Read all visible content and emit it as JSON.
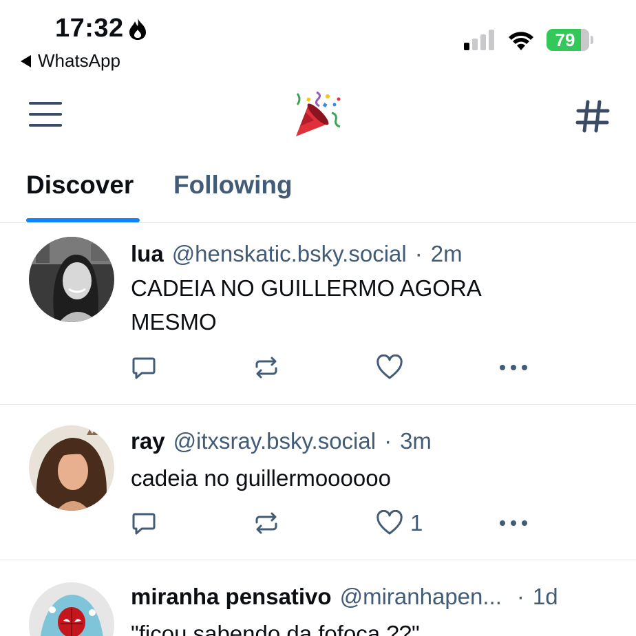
{
  "status_bar": {
    "time": "17:32",
    "back_app": "WhatsApp",
    "battery": "79"
  },
  "header": {
    "menu_icon": "hamburger-menu-icon",
    "logo_icon": "party-popper-icon",
    "feeds_icon": "hashtag-icon"
  },
  "tabs": [
    {
      "label": "Discover",
      "active": true
    },
    {
      "label": "Following",
      "active": false
    }
  ],
  "posts": [
    {
      "name": "lua",
      "handle": "@henskatic.bsky.social",
      "separator": "·",
      "time": "2m",
      "text": "CADEIA NO GUILLERMO AGORA MESMO",
      "likes": ""
    },
    {
      "name": "ray",
      "handle": "@itxsray.bsky.social",
      "separator": "·",
      "time": "3m",
      "text": "cadeia no guillermoooooo",
      "likes": "1"
    },
    {
      "name": "miranha pensativo",
      "handle": "@miranhapen...",
      "separator": "·",
      "time": "1d",
      "text": "\"ficou sabendo da fofoca ??\""
    }
  ],
  "colors": {
    "accent": "#1083fe",
    "muted": "#425b76",
    "battery": "#34c759"
  }
}
